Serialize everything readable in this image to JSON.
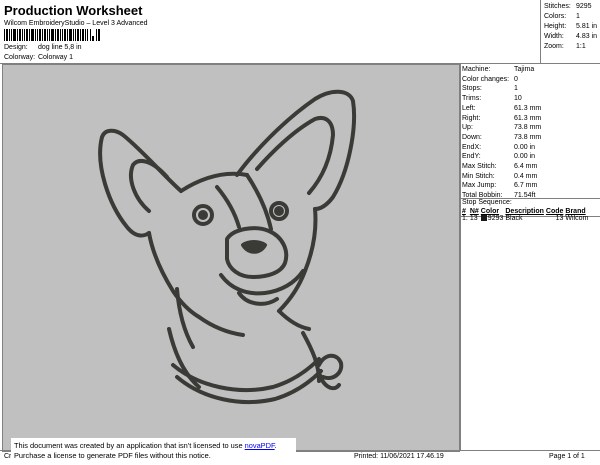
{
  "header": {
    "title": "Production Worksheet",
    "subtitle": "Wilcom EmbroideryStudio – Level 3 Advanced",
    "design_label": "Design:",
    "design_value": "dog line 5,8 in",
    "colorway_label": "Colorway:",
    "colorway_value": "Colorway 1"
  },
  "stats": [
    {
      "label": "Stitches:",
      "value": "9295"
    },
    {
      "label": "Colors:",
      "value": "1"
    },
    {
      "label": "Height:",
      "value": "5.81 in"
    },
    {
      "label": "Width:",
      "value": "4.83 in"
    },
    {
      "label": "Zoom:",
      "value": "1:1"
    }
  ],
  "machine_info": [
    {
      "label": "Machine:",
      "value": "Tajima"
    },
    {
      "label": "Color changes:",
      "value": "0"
    },
    {
      "label": "Stops:",
      "value": "1"
    },
    {
      "label": "Trims:",
      "value": "10"
    },
    {
      "label": "Left:",
      "value": "61.3 mm"
    },
    {
      "label": "Right:",
      "value": "61.3 mm"
    },
    {
      "label": "Up:",
      "value": "73.8 mm"
    },
    {
      "label": "Down:",
      "value": "73.8 mm"
    },
    {
      "label": "EndX:",
      "value": "0.00 in"
    },
    {
      "label": "EndY:",
      "value": "0.00 in"
    },
    {
      "label": "Max Stitch:",
      "value": "6.4 mm"
    },
    {
      "label": "Min Stitch:",
      "value": "0.4 mm"
    },
    {
      "label": "Max Jump:",
      "value": "6.7 mm"
    },
    {
      "label": "Total Bobbin:",
      "value": "71.54ft"
    }
  ],
  "stop_sequence": {
    "title": "Stop Sequence:",
    "headers": [
      "#",
      "N#",
      "Color",
      "Description",
      "Code",
      "Brand"
    ],
    "rows": [
      {
        "num": "1.",
        "n": "13",
        "color": "9293",
        "description": "Black",
        "code": "13",
        "brand": "Wilcom",
        "swatch": "#1a1a1a"
      }
    ]
  },
  "footer": {
    "left": "Cr",
    "printed": "Printed: 11/06/2021 17.46.19",
    "page": "Page 1 of 1"
  },
  "notice": {
    "line1": "This document was created by an application that isn't licensed to use ",
    "link": "novaPDF",
    "line1_end": ".",
    "line2": "Purchase a license to generate PDF files without this notice."
  },
  "colors": {
    "design_bg": "#c0c0c0",
    "thread": "#3a3a36"
  }
}
